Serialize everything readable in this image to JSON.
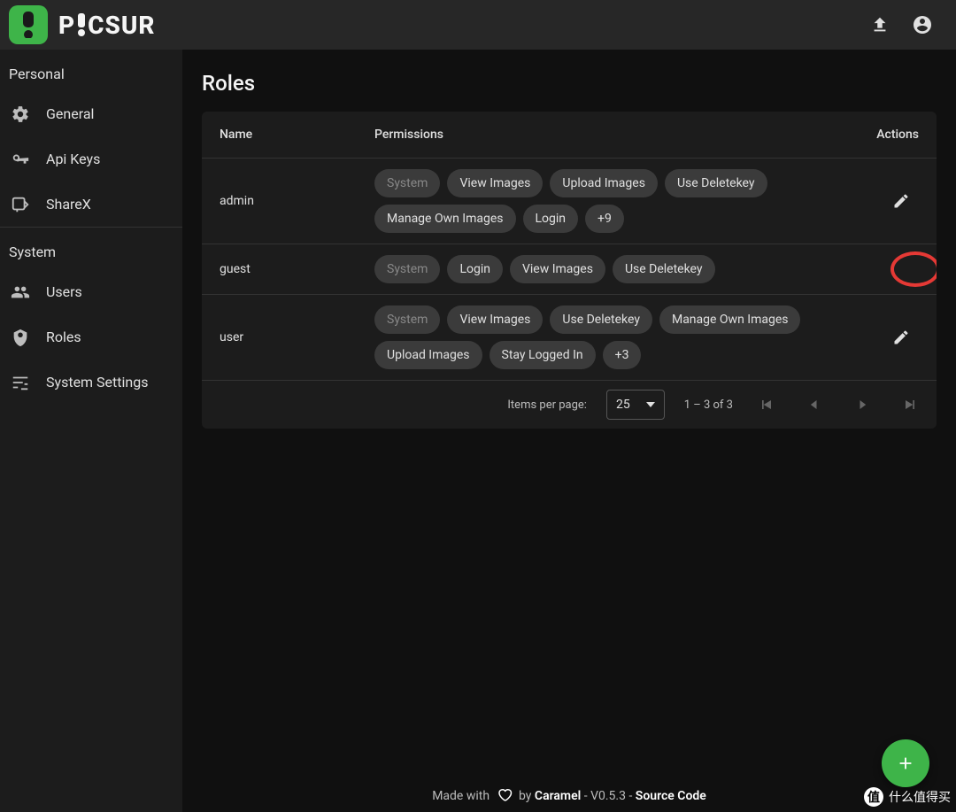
{
  "appbar": {
    "brand": "PICSUR"
  },
  "sidebar": {
    "sections": [
      {
        "header": "Personal",
        "items": [
          {
            "icon": "gear",
            "label": "General"
          },
          {
            "icon": "key",
            "label": "Api Keys"
          },
          {
            "icon": "share",
            "label": "ShareX"
          }
        ]
      },
      {
        "header": "System",
        "items": [
          {
            "icon": "people",
            "label": "Users"
          },
          {
            "icon": "shield",
            "label": "Roles"
          },
          {
            "icon": "tune",
            "label": "System Settings"
          }
        ]
      }
    ]
  },
  "page": {
    "title": "Roles",
    "columns": {
      "name": "Name",
      "permissions": "Permissions",
      "actions": "Actions"
    },
    "rows": [
      {
        "name": "admin",
        "perms": [
          {
            "label": "System",
            "muted": true
          },
          {
            "label": "View Images"
          },
          {
            "label": "Upload Images"
          },
          {
            "label": "Use Deletekey"
          },
          {
            "label": "Manage Own Images"
          },
          {
            "label": "Login"
          },
          {
            "label": "+9"
          }
        ],
        "highlighted": false
      },
      {
        "name": "guest",
        "perms": [
          {
            "label": "System",
            "muted": true
          },
          {
            "label": "Login"
          },
          {
            "label": "View Images"
          },
          {
            "label": "Use Deletekey"
          }
        ],
        "highlighted": true
      },
      {
        "name": "user",
        "perms": [
          {
            "label": "System",
            "muted": true
          },
          {
            "label": "View Images"
          },
          {
            "label": "Use Deletekey"
          },
          {
            "label": "Manage Own Images"
          },
          {
            "label": "Upload Images"
          },
          {
            "label": "Stay Logged In"
          },
          {
            "label": "+3"
          }
        ],
        "highlighted": false
      }
    ],
    "paginator": {
      "items_per_page_label": "Items per page:",
      "items_per_page_value": "25",
      "range_label": "1 – 3 of 3"
    }
  },
  "footer": {
    "made_with": "Made with",
    "by": "by",
    "author": "Caramel",
    "version": " - V0.5.3 - ",
    "source": "Source Code"
  },
  "watermark": {
    "char": "值",
    "text": "什么值得买"
  }
}
